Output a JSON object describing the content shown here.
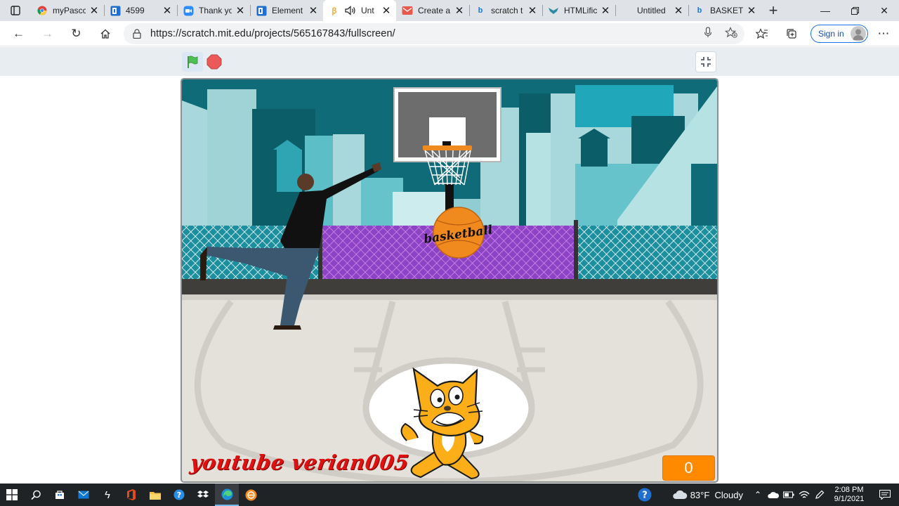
{
  "browser": {
    "tabs": [
      {
        "title": "myPascc",
        "favicon": "chrome-icon"
      },
      {
        "title": "4599",
        "favicon": "letter-icon"
      },
      {
        "title": "Thank yo",
        "favicon": "zoom-icon"
      },
      {
        "title": "Element",
        "favicon": "letter-icon"
      },
      {
        "title": "Unt",
        "favicon": "scratch-icon",
        "active": true
      },
      {
        "title": "Create a",
        "favicon": "mail-icon"
      },
      {
        "title": "scratch t",
        "favicon": "bing-icon"
      },
      {
        "title": "HTMLific",
        "favicon": "bird-icon"
      },
      {
        "title": "Untitled",
        "favicon": ""
      },
      {
        "title": "BASKET",
        "favicon": "bing-icon"
      }
    ],
    "url": "https://scratch.mit.edu/projects/565167843/fullscreen/",
    "sign_in_label": "Sign in"
  },
  "stage": {
    "watermark": "youtube verian005",
    "score": "0",
    "ball_label": "basketball"
  },
  "taskbar": {
    "weather": "83°F  Cloudy",
    "time": "2:08 PM",
    "date": "9/1/2021"
  },
  "colors": {
    "accent": "#ff8a00",
    "sky": "#0f6b78",
    "court": "#e3e1da",
    "watermark": "#e01010"
  }
}
